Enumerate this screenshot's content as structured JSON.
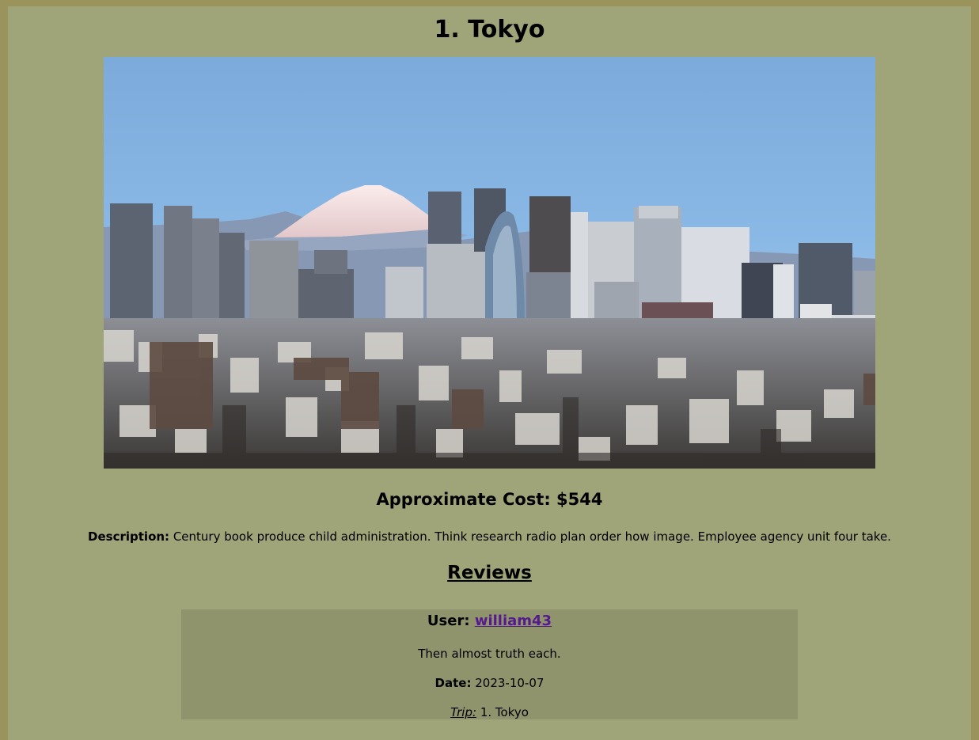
{
  "destination": {
    "title": "1. Tokyo",
    "cost_label": "Approximate Cost: $544",
    "description_label": "Description:",
    "description_text": "Century book produce child administration. Think research radio plan order how image. Employee agency unit four take.",
    "photo_icon": "tokyo-skyline-photo"
  },
  "reviews": {
    "heading": "Reviews",
    "items": [
      {
        "user_label": "User:",
        "username": "william43",
        "text": "Then almost truth each.",
        "date_label": "Date:",
        "date": "2023-10-07",
        "trip_label": "Trip:",
        "trip": "1. Tokyo"
      }
    ]
  },
  "colors": {
    "outer_frame": "#9a945c",
    "page_background": "#9fa479",
    "review_card": "#8f946c",
    "link": "#551a8b",
    "sky": "#7faedc",
    "mountain_snow": "#f2e3e3"
  }
}
